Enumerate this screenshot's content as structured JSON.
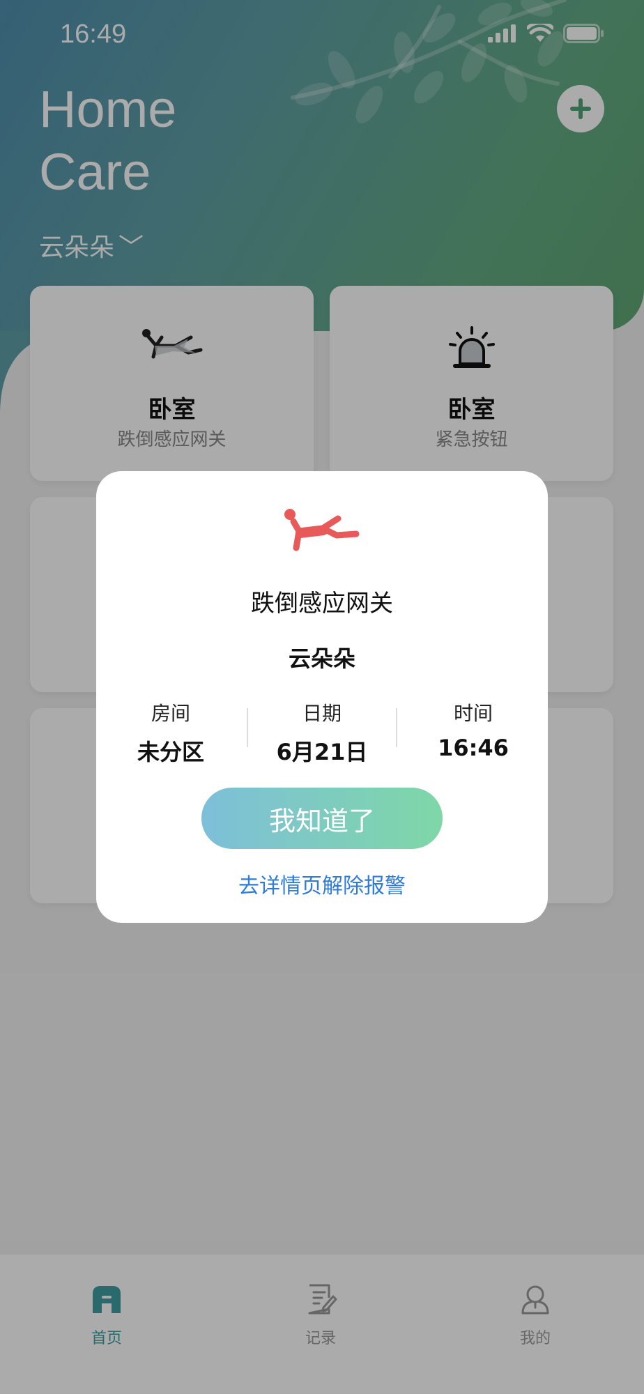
{
  "status_bar": {
    "time": "16:49"
  },
  "header": {
    "title_line1": "Home",
    "title_line2": "Care",
    "user_name": "云朵朵",
    "user_chevron": "﹀"
  },
  "devices": [
    {
      "room": "卧室",
      "type": "跌倒感应网关",
      "icon": "fall-person-icon"
    },
    {
      "room": "卧室",
      "type": "紧急按钮",
      "icon": "alarm-siren-icon"
    }
  ],
  "alert": {
    "icon": "fall-person-icon",
    "device": "跌倒感应网关",
    "user": "云朵朵",
    "room_label": "房间",
    "room_value": "未分区",
    "date_label": "日期",
    "date_value": "6月21日",
    "time_label": "时间",
    "time_value": "16:46",
    "ack_button": "我知道了",
    "detail_link": "去详情页解除报警"
  },
  "tabbar": {
    "items": [
      {
        "label": "首页",
        "icon": "home-icon",
        "active": true
      },
      {
        "label": "记录",
        "icon": "record-icon",
        "active": false
      },
      {
        "label": "我的",
        "icon": "profile-icon",
        "active": false
      }
    ]
  },
  "colors": {
    "accent": "#3f9da1",
    "alert_red": "#e85a5a",
    "link_blue": "#2f7bd9",
    "button_gradient_start": "#7dbfd9",
    "button_gradient_end": "#7fd7a7"
  }
}
